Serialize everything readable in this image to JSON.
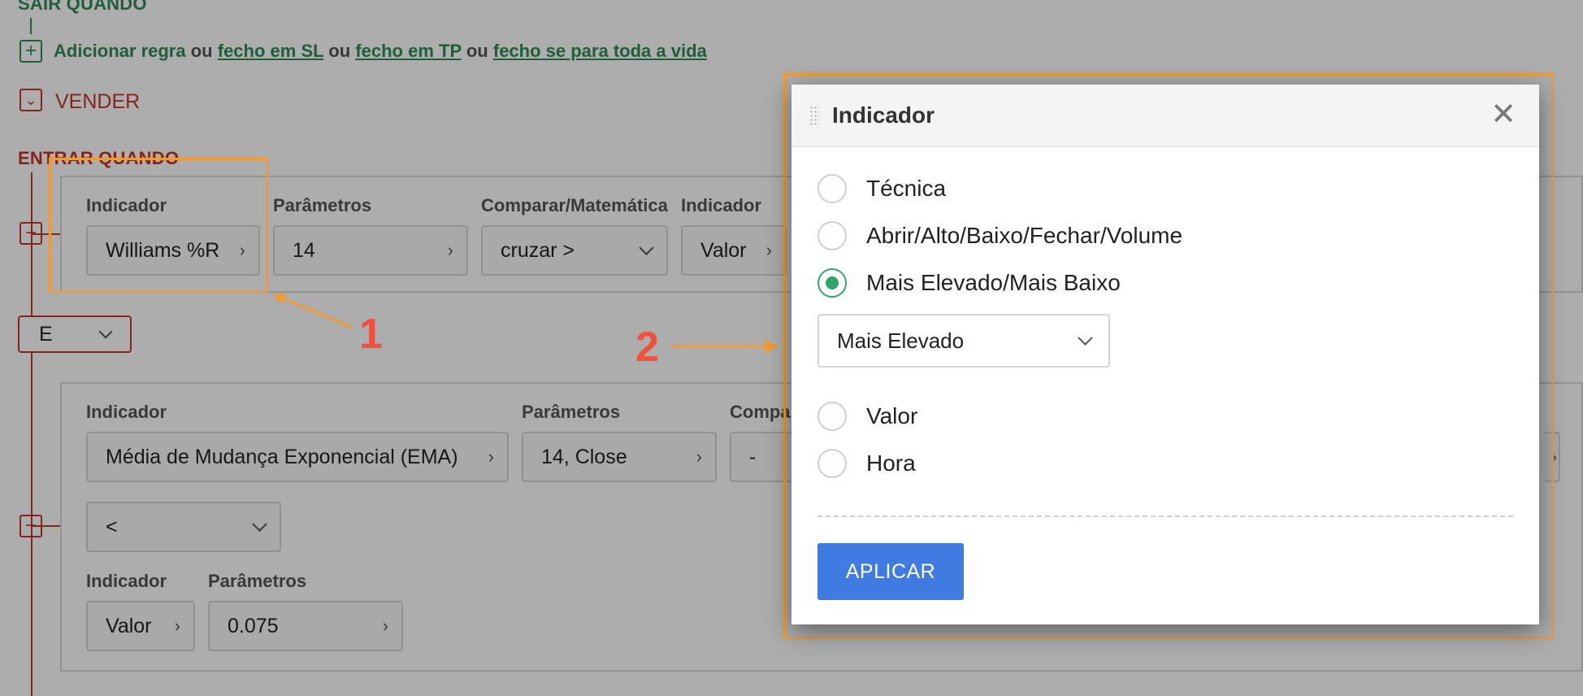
{
  "exit_section": {
    "title": "SAIR QUANDO",
    "add_rule_prefix": "Adicionar regra",
    "or1": "ou",
    "link_sl": "fecho em SL",
    "or2": "ou",
    "link_tp": "fecho em TP",
    "or3": "ou",
    "link_life": "fecho se para toda a vida"
  },
  "sell": {
    "label": "VENDER"
  },
  "enter_section": {
    "title": "ENTRAR QUANDO"
  },
  "rule1": {
    "label_indicator": "Indicador",
    "indicator_value": "Williams %R",
    "label_params": "Parâmetros",
    "params_value": "14",
    "label_compare": "Comparar/Matemática",
    "compare_value": "cruzar >",
    "label_indicator2": "Indicador",
    "indicator2_value": "Valor"
  },
  "logic_select": {
    "value": "E"
  },
  "rule2": {
    "label_indicator": "Indicador",
    "indicator_value": "Média de Mudança Exponencial (EMA)",
    "label_params": "Parâmetros",
    "params_value": "14, Close",
    "label_compare": "Compa",
    "compare_value": "-",
    "operator_value": "<",
    "label_indicator2": "Indicador",
    "indicator2_value": "Valor",
    "label_params2": "Parâmetros",
    "params2_value": "0.075"
  },
  "annotations": {
    "one": "1",
    "two": "2",
    "color": "#f39b32",
    "number_color": "#f0503c"
  },
  "modal": {
    "title": "Indicador",
    "options": [
      "Técnica",
      "Abrir/Alto/Baixo/Fechar/Volume",
      "Mais Elevado/Mais Baixo",
      "Valor",
      "Hora"
    ],
    "selected": "Mais Elevado/Mais Baixo",
    "sub_select_value": "Mais Elevado",
    "apply_label": "APLICAR",
    "accent": "#2fa56a",
    "button_color": "#3f7be0"
  }
}
